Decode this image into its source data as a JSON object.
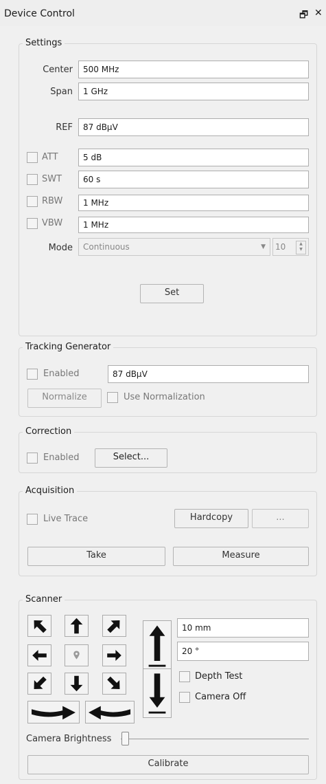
{
  "window": {
    "title": "Device Control",
    "float_icon": "float-icon",
    "close_icon": "close-icon"
  },
  "settings": {
    "group_title": "Settings",
    "center_label": "Center",
    "center_value": "500 MHz",
    "span_label": "Span",
    "span_value": "1 GHz",
    "ref_label": "REF",
    "ref_value": "87 dBµV",
    "att_label": "ATT",
    "att_value": "5 dB",
    "swt_label": "SWT",
    "swt_value": "60 s",
    "rbw_label": "RBW",
    "rbw_value": "1 MHz",
    "vbw_label": "VBW",
    "vbw_value": "1 MHz",
    "mode_label": "Mode",
    "mode_value": "Continuous",
    "count_value": "10",
    "set_button": "Set"
  },
  "tracking": {
    "group_title": "Tracking Generator",
    "enabled_label": "Enabled",
    "level_value": "87 dBµV",
    "normalize_button": "Normalize",
    "use_normalization_label": "Use Normalization"
  },
  "correction": {
    "group_title": "Correction",
    "enabled_label": "Enabled",
    "select_button": "Select..."
  },
  "acquisition": {
    "group_title": "Acquisition",
    "live_trace_label": "Live Trace",
    "hardcopy_button": "Hardcopy",
    "more_button": "...",
    "take_button": "Take",
    "measure_button": "Measure"
  },
  "scanner": {
    "group_title": "Scanner",
    "step_value": "10 mm",
    "angle_value": "20 °",
    "depth_test_label": "Depth Test",
    "camera_off_label": "Camera Off",
    "camera_brightness_label": "Camera Brightness",
    "camera_brightness_level": 0,
    "calibrate_button": "Calibrate"
  }
}
